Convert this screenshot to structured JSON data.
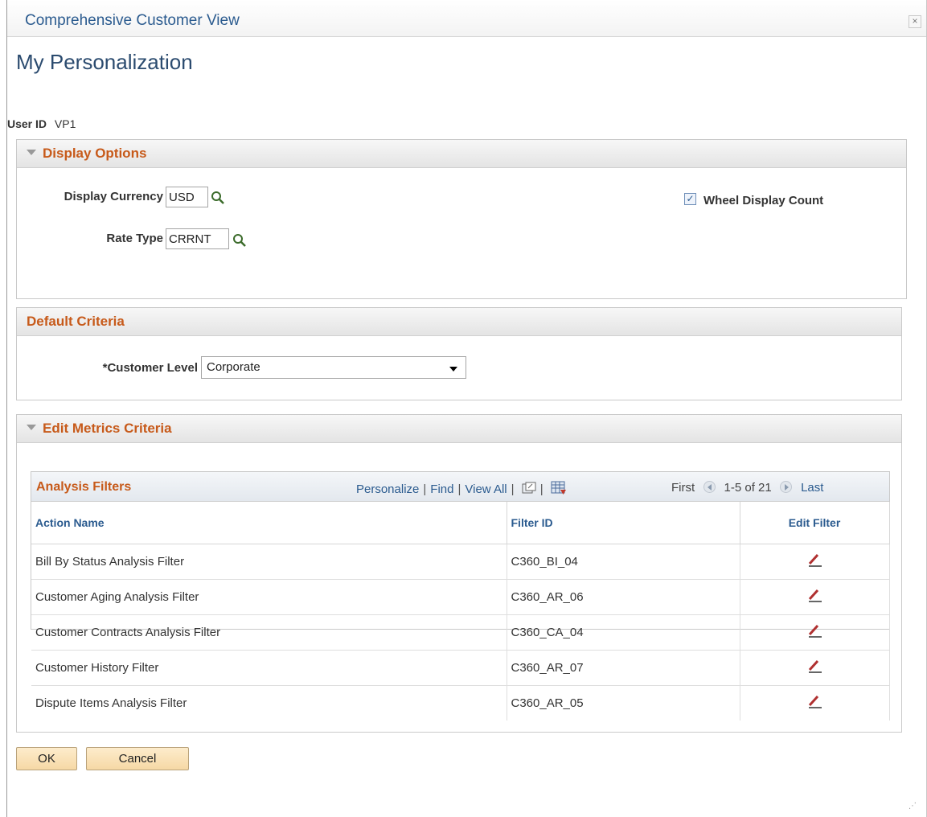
{
  "window": {
    "title": "Comprehensive Customer View",
    "close_label": "×"
  },
  "page_title": "My Personalization",
  "user": {
    "label": "User ID",
    "value": "VP1"
  },
  "display_options": {
    "header": "Display Options",
    "currency_label": "Display Currency",
    "currency_value": "USD",
    "rate_type_label": "Rate Type",
    "rate_type_value": "CRRNT",
    "wheel_label": "Wheel Display Count",
    "wheel_checked": true
  },
  "default_criteria": {
    "header": "Default Criteria",
    "customer_level_label": "*Customer Level",
    "customer_level_value": "Corporate"
  },
  "metrics": {
    "header": "Edit Metrics Criteria",
    "grid": {
      "title": "Analysis Filters",
      "links": [
        "Personalize",
        "Find",
        "View All"
      ],
      "pager": {
        "first": "First",
        "range": "1-5 of 21",
        "last": "Last"
      },
      "columns": [
        "Action Name",
        "Filter ID",
        "Edit Filter"
      ],
      "rows": [
        {
          "action": "Bill By Status Analysis Filter",
          "filter_id": "C360_BI_04"
        },
        {
          "action": "Customer Aging Analysis Filter",
          "filter_id": "C360_AR_06"
        },
        {
          "action": "Customer Contracts Analysis Filter",
          "filter_id": "C360_CA_04"
        },
        {
          "action": "Customer History Filter",
          "filter_id": "C360_AR_07"
        },
        {
          "action": "Dispute Items Analysis Filter",
          "filter_id": "C360_AR_05"
        }
      ]
    }
  },
  "buttons": {
    "ok": "OK",
    "cancel": "Cancel"
  },
  "colors": {
    "section_header": "#c75a1a",
    "link": "#2b5b8f",
    "button_bg": "#fbe3b8"
  }
}
